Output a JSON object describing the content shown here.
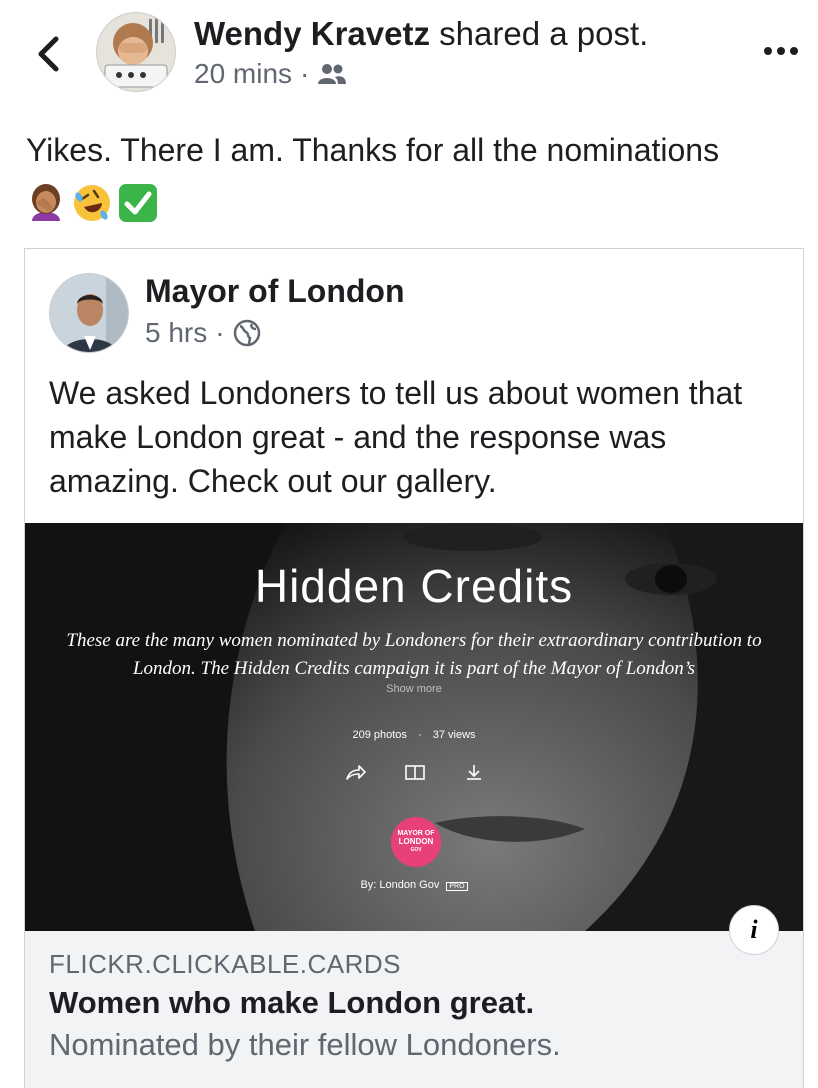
{
  "header": {
    "poster_name": "Wendy Kravetz",
    "poster_action": "shared a post.",
    "time": "20 mins",
    "separator": "·",
    "audience_icon": "friends-icon",
    "more_icon": "more-dots-icon",
    "back_icon": "chevron-left-icon"
  },
  "post": {
    "text": "Yikes. There I am. Thanks for all the nominations",
    "emojis": [
      "face-palm-woman-emoji",
      "rolling-on-floor-laughing-emoji",
      "check-mark-button-emoji"
    ]
  },
  "shared": {
    "page_name": "Mayor of London",
    "time": "5 hrs",
    "separator": "·",
    "audience_icon": "globe-icon",
    "text": "We asked Londoners to tell us about women that make London great - and the response was amazing. Check out our gallery."
  },
  "link_preview": {
    "image": {
      "title": "Hidden Credits",
      "description_line1": "These are the many women nominated by Londoners for their extraordinary contribution to",
      "description_line2": "London. The Hidden Credits campaign it is part of the Mayor of London’s",
      "show_more": "Show more",
      "photos": "209 photos",
      "dot": "·",
      "views": "37 views",
      "badge_line1": "MAYOR OF",
      "badge_line2": "LONDON",
      "badge_line3": "GOV",
      "by": "By: London Gov",
      "pro": "PRO"
    },
    "info_label": "i",
    "domain": "FLICKR.CLICKABLE.CARDS",
    "title": "Women who make London great.",
    "subtitle": "Nominated by their fellow Londoners."
  },
  "colors": {
    "text_primary": "#1c1e21",
    "text_secondary": "#606770",
    "caption_bg": "#f2f3f5",
    "badge_pink": "#e8417a",
    "check_green": "#3bb54a"
  }
}
